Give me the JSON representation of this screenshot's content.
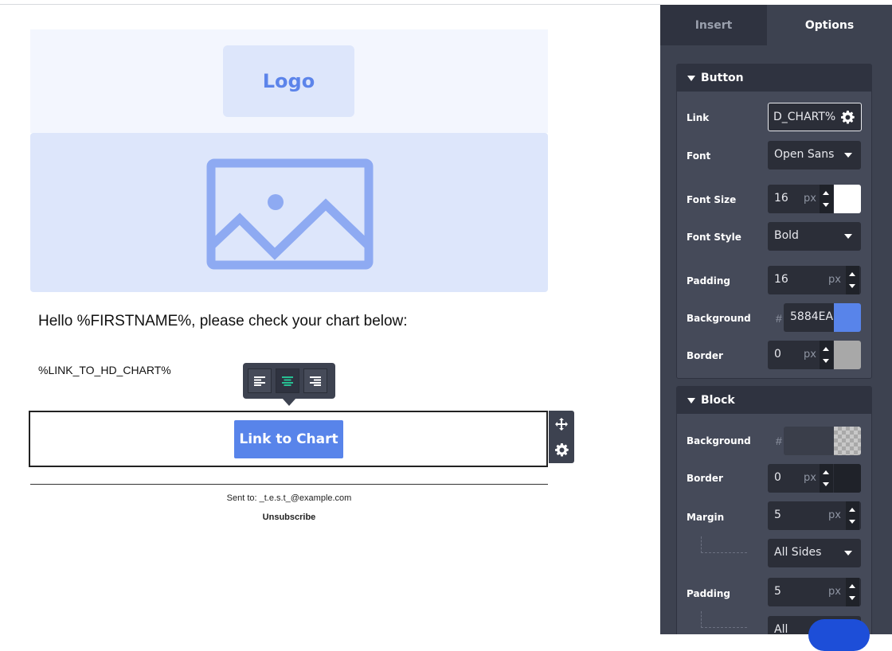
{
  "email": {
    "logo_text": "Logo",
    "greeting": "Hello %FIRSTNAME%, please check your chart below:",
    "link_placeholder": "%LINK_TO_HD_CHART%",
    "button_label": "Link to Chart",
    "sent_to": "Sent to: _t.e.s.t_@example.com",
    "unsubscribe": "Unsubscribe"
  },
  "panel": {
    "tabs": [
      {
        "label": "Insert"
      },
      {
        "label": "Options"
      }
    ],
    "button_section": {
      "title": "Button",
      "link_label": "Link",
      "link_value": "D_CHART%",
      "font_label": "Font",
      "font_value": "Open Sans",
      "font_size_label": "Font Size",
      "font_size_value": "16",
      "font_style_label": "Font Style",
      "font_style_value": "Bold",
      "padding_label": "Padding",
      "padding_value": "16",
      "background_label": "Background",
      "background_value": "5884EA",
      "border_label": "Border",
      "border_value": "0",
      "unit": "px",
      "hash": "#"
    },
    "block_section": {
      "title": "Block",
      "background_label": "Background",
      "border_label": "Border",
      "border_value": "0",
      "margin_label": "Margin",
      "margin_value": "5",
      "margin_sides": "All Sides",
      "padding_label": "Padding",
      "padding_value": "5",
      "padding_sides": "All"
    }
  },
  "colors": {
    "accent": "#5884ea",
    "panel_bg": "#3d4250",
    "active_align": "#27c093"
  }
}
